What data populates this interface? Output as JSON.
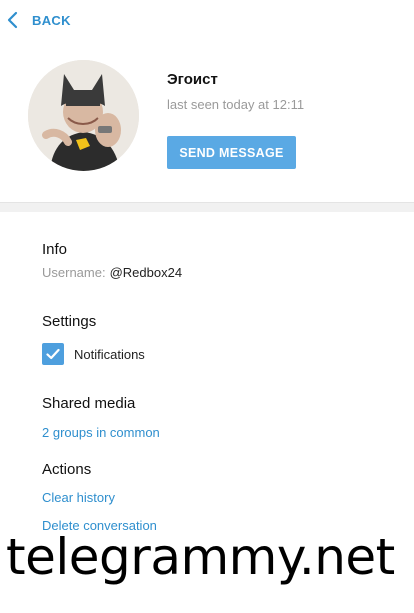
{
  "header": {
    "back_label": "BACK"
  },
  "profile": {
    "name": "Эгоист",
    "status": "last seen today at 12:11",
    "send_message_label": "SEND MESSAGE"
  },
  "info": {
    "title": "Info",
    "username_key": "Username:",
    "username_value": "@Redbox24"
  },
  "settings": {
    "title": "Settings",
    "notifications_label": "Notifications",
    "notifications_checked": true
  },
  "shared_media": {
    "title": "Shared media",
    "groups_link": "2 groups in common"
  },
  "actions": {
    "title": "Actions",
    "clear_history": "Clear history",
    "delete_conversation": "Delete conversation"
  },
  "watermark": "telegrammy.net",
  "colors": {
    "accent": "#2f8fce",
    "button": "#5aa9e4",
    "checkbox": "#4e9fde",
    "muted": "#9a9a9a"
  }
}
